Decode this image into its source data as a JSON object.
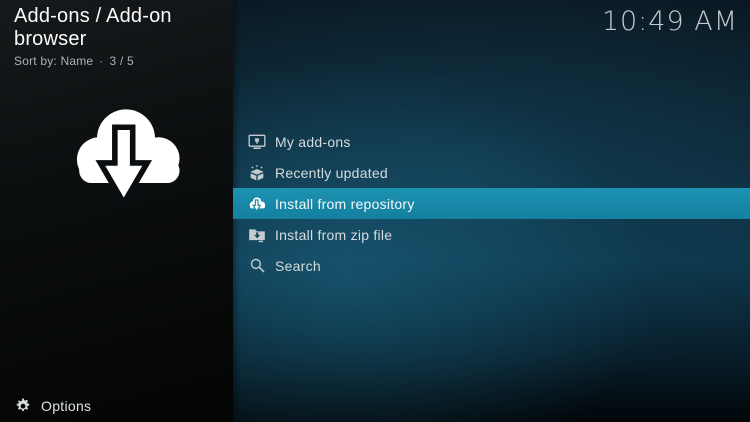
{
  "header": {
    "title": "Add-ons / Add-on browser",
    "sort_label": "Sort by: Name",
    "separator": "·",
    "position": "3 / 5",
    "clock": "10:49 AM"
  },
  "menu": {
    "items": [
      {
        "label": "My add-ons",
        "icon": "my-addons-icon",
        "selected": false
      },
      {
        "label": "Recently updated",
        "icon": "recently-updated-icon",
        "selected": false
      },
      {
        "label": "Install from repository",
        "icon": "cloud-download-icon",
        "selected": true
      },
      {
        "label": "Install from zip file",
        "icon": "zip-file-icon",
        "selected": false
      },
      {
        "label": "Search",
        "icon": "search-icon",
        "selected": false
      }
    ]
  },
  "left_panel": {
    "icon": "cloud-download-icon"
  },
  "footer": {
    "options_label": "Options"
  },
  "colors": {
    "highlight": "#1787a7",
    "panel_dark": "#0c0f10",
    "backdrop_teal": "#0e3549"
  }
}
